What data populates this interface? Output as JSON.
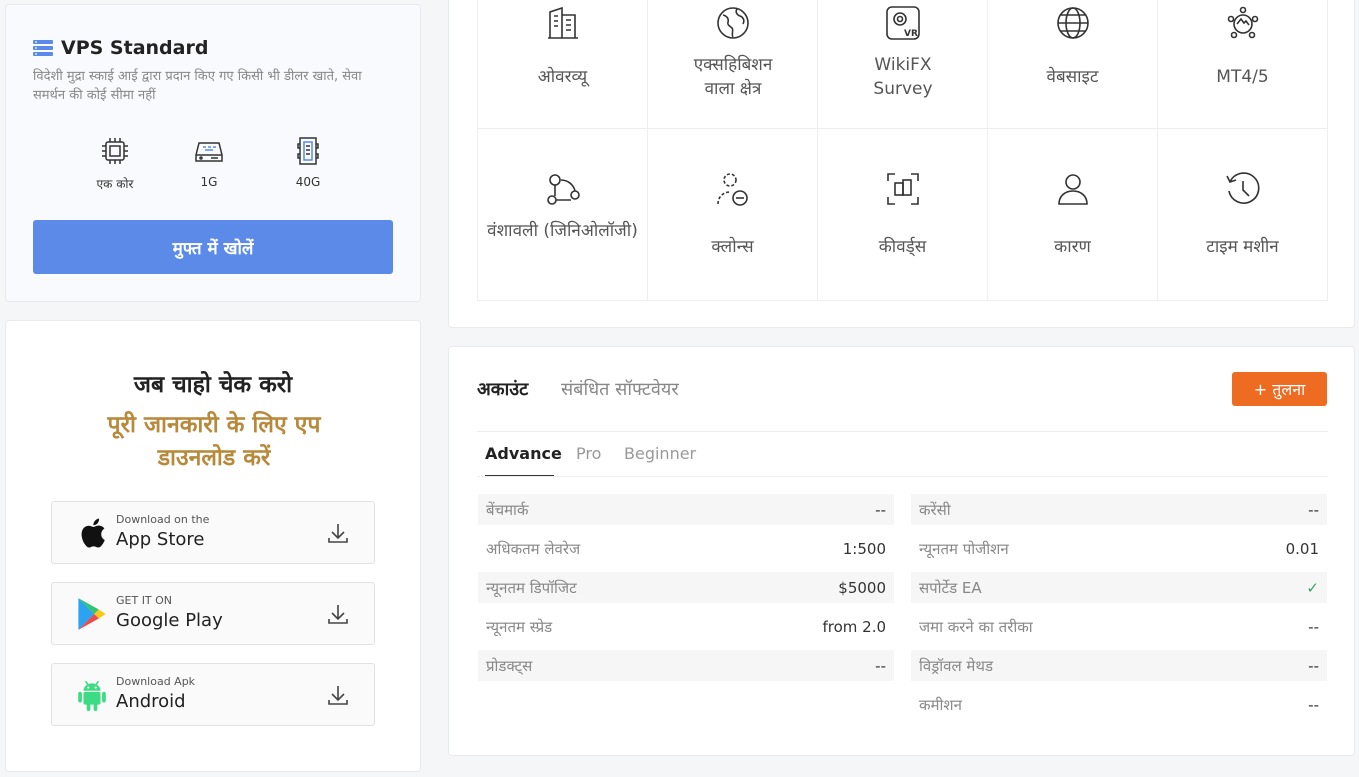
{
  "vps": {
    "title": "VPS Standard",
    "description": "विदेशी मुद्रा स्काई आई द्वारा प्रदान किए गए किसी भी डीलर खाते, सेवा समर्थन की कोई सीमा नहीं",
    "specs": [
      {
        "icon": "cpu-icon",
        "label": "एक कोर"
      },
      {
        "icon": "memory-icon",
        "label": "1G"
      },
      {
        "icon": "storage-icon",
        "label": "40G"
      }
    ],
    "button_label": "मुफ्त में खोलें",
    "accent_color": "#5b8ae8"
  },
  "app_download": {
    "line1": "जब चाहो चेक करो",
    "line2": "पूरी जानकारी के लिए एप डाउनलोड करें",
    "highlight_color": "#b8893a",
    "stores": [
      {
        "icon": "apple-icon",
        "small": "Download on the",
        "big": "App Store"
      },
      {
        "icon": "google-play-icon",
        "small": "GET IT ON",
        "big": "Google Play"
      },
      {
        "icon": "android-icon",
        "small": "Download Apk",
        "big": "Android"
      }
    ]
  },
  "grid": {
    "items": [
      {
        "icon": "overview-icon",
        "label": "ओवरव्यू"
      },
      {
        "icon": "exhibition-icon",
        "label": "एक्सहिबिशन वाला क्षेत्र"
      },
      {
        "icon": "vr-survey-icon",
        "label": "WikiFX Survey"
      },
      {
        "icon": "globe-icon",
        "label": "वेबसाइट"
      },
      {
        "icon": "mt45-icon",
        "label": "MT4/5"
      },
      {
        "icon": "genealogy-icon",
        "label": "वंशावली (जिनिओलॉजी)"
      },
      {
        "icon": "clone-icon",
        "label": "क्लोन्स"
      },
      {
        "icon": "keywords-icon",
        "label": "कीवर्ड्स"
      },
      {
        "icon": "user-icon",
        "label": "कारण"
      },
      {
        "icon": "time-machine-icon",
        "label": "टाइम मशीन"
      }
    ]
  },
  "account": {
    "tabs": [
      "अकाउंट",
      "संबंधित सॉफ्टवेयर"
    ],
    "compare_label": "+ तुलना",
    "compare_color": "#ee6b22",
    "sub_tabs": [
      "Advance",
      "Pro",
      "Beginner"
    ],
    "left_rows": [
      {
        "label": "बेंचमार्क",
        "value": "--"
      },
      {
        "label": "अधिकतम लेवरेज",
        "value": "1:500"
      },
      {
        "label": "न्यूनतम डिपॉजिट",
        "value": "$5000"
      },
      {
        "label": "न्यूनतम स्प्रेड",
        "value": "from 2.0"
      },
      {
        "label": "प्रोडक्ट्स",
        "value": "--"
      }
    ],
    "right_rows": [
      {
        "label": "करेंसी",
        "value": "--"
      },
      {
        "label": "न्यूनतम पोजीशन",
        "value": "0.01"
      },
      {
        "label": "सपोर्टेड EA",
        "value": "✓"
      },
      {
        "label": "जमा करने का तरीका",
        "value": "--"
      },
      {
        "label": "विड्रॉवल मेथड",
        "value": "--"
      },
      {
        "label": "कमीशन",
        "value": "--"
      }
    ]
  }
}
